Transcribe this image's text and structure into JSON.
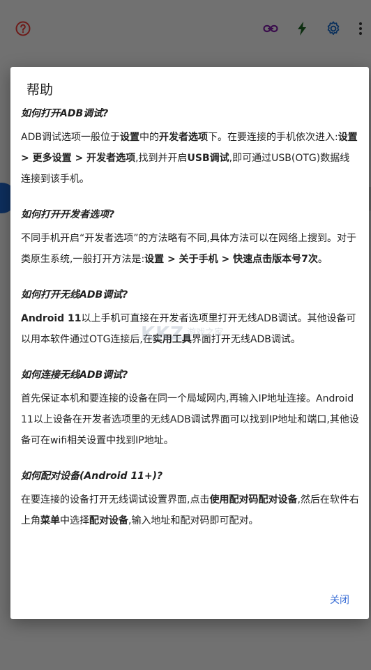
{
  "dialog": {
    "title": "帮助",
    "close_label": "关闭",
    "sections": [
      {
        "question": "如何打开ADB调试?",
        "answer": [
          {
            "t": "ADB调试选项一般位于",
            "b": false
          },
          {
            "t": "设置",
            "b": true
          },
          {
            "t": "中的",
            "b": false
          },
          {
            "t": "开发者选项",
            "b": true
          },
          {
            "t": "下。在要连接的手机依次进入:",
            "b": false
          },
          {
            "t": "设置 > 更多设置 > 开发者选项",
            "b": true
          },
          {
            "t": ",找到并开启",
            "b": false
          },
          {
            "t": "USB调试",
            "b": true
          },
          {
            "t": ",即可通过USB(OTG)数据线连接到该手机。",
            "b": false
          }
        ]
      },
      {
        "question": "如何打开开发者选项?",
        "answer": [
          {
            "t": "不同手机开启“开发者选项”的方法略有不同,具体方法可以在网络上搜到。对于类原生系统,一般打开方法是:",
            "b": false
          },
          {
            "t": "设置 > 关于手机 > 快速点击版本号7次",
            "b": true
          },
          {
            "t": "。",
            "b": false
          }
        ]
      },
      {
        "question": "如何打开无线ADB调试?",
        "answer": [
          {
            "t": "Android 11",
            "b": true
          },
          {
            "t": "以上手机可直接在开发者选项里打开无线ADB调试。其他设备可以用本软件通过OTG连接后,在",
            "b": false
          },
          {
            "t": "实用工具",
            "b": true
          },
          {
            "t": "界面打开无线ADB调试。",
            "b": false
          }
        ]
      },
      {
        "question": "如何连接无线ADB调试?",
        "answer": [
          {
            "t": "首先保证本机和要连接的设备在同一个局域网内,再输入IP地址连接。Android 11以上设备在开发者选项里的无线ADB调试界面可以找到IP地址和端口,其他设备可在wifi相关设置中找到IP地址。",
            "b": false
          }
        ]
      },
      {
        "question": "如何配对设备(Android 11+)?",
        "answer": [
          {
            "t": "在要连接的设备打开无线调试设置界面,点击",
            "b": false
          },
          {
            "t": "使用配对码配对设备",
            "b": true
          },
          {
            "t": ",然后在软件右上角",
            "b": false
          },
          {
            "t": "菜单",
            "b": true
          },
          {
            "t": "中选择",
            "b": false
          },
          {
            "t": "配对设备",
            "b": true
          },
          {
            "t": ",输入地址和配对码即可配对。",
            "b": false
          }
        ]
      }
    ]
  },
  "watermark": {
    "main": "KKZ",
    "sub": "游戏之家"
  },
  "toolbar": {
    "icons": [
      "help-icon",
      "link-icon",
      "flash-icon",
      "settings-icon",
      "more-vert-icon"
    ]
  },
  "colors": {
    "help_icon": "#e53935",
    "link_icon": "#7b1fa2",
    "flash_icon": "#1b5e20",
    "settings_icon": "#1565c0",
    "accent_blue": "#1e63c4",
    "link_text": "#3b6fd6"
  }
}
